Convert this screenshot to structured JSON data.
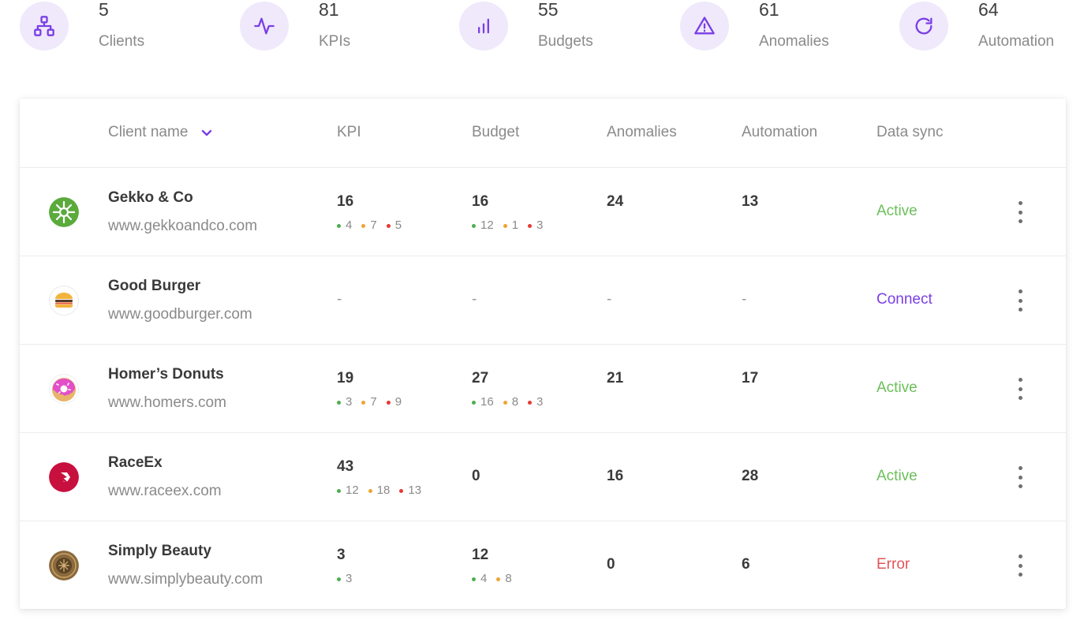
{
  "stats": [
    {
      "value": "5",
      "label": "Clients",
      "icon": "sitemap-icon"
    },
    {
      "value": "81",
      "label": "KPIs",
      "icon": "pulse-icon"
    },
    {
      "value": "55",
      "label": "Budgets",
      "icon": "bar-chart-icon"
    },
    {
      "value": "61",
      "label": "Anomalies",
      "icon": "warning-icon"
    },
    {
      "value": "64",
      "label": "Automation",
      "icon": "refresh-icon"
    }
  ],
  "table": {
    "headers": {
      "client": "Client name",
      "kpi": "KPI",
      "budget": "Budget",
      "anomalies": "Anomalies",
      "automation": "Automation",
      "sync": "Data sync"
    },
    "empty_placeholder": "-",
    "rows": [
      {
        "name": "Gekko & Co",
        "url": "www.gekkoandco.com",
        "logo": "gekko-logo",
        "kpi": {
          "total": "16",
          "green": "4",
          "orange": "7",
          "red": "5"
        },
        "budget": {
          "total": "16",
          "green": "12",
          "orange": "1",
          "red": "3"
        },
        "anomalies": "24",
        "automation": "13",
        "sync": "Active",
        "sync_color": "#6cbf5a"
      },
      {
        "name": "Good Burger",
        "url": "www.goodburger.com",
        "logo": "burger-logo",
        "kpi": null,
        "budget": null,
        "anomalies": null,
        "automation": null,
        "sync": "Connect",
        "sync_color": "#7b3fe4"
      },
      {
        "name": "Homer’s Donuts",
        "url": "www.homers.com",
        "logo": "donut-logo",
        "kpi": {
          "total": "19",
          "green": "3",
          "orange": "7",
          "red": "9"
        },
        "budget": {
          "total": "27",
          "green": "16",
          "orange": "8",
          "red": "3"
        },
        "anomalies": "21",
        "automation": "17",
        "sync": "Active",
        "sync_color": "#6cbf5a"
      },
      {
        "name": "RaceEx",
        "url": "www.raceex.com",
        "logo": "raceex-logo",
        "kpi": {
          "total": "43",
          "green": "12",
          "orange": "18",
          "red": "13"
        },
        "budget": {
          "total": "0"
        },
        "anomalies": "16",
        "automation": "28",
        "sync": "Active",
        "sync_color": "#6cbf5a"
      },
      {
        "name": "Simply Beauty",
        "url": "www.simplybeauty.com",
        "logo": "beauty-logo",
        "kpi": {
          "total": "3",
          "green": "3"
        },
        "budget": {
          "total": "12",
          "green": "4",
          "orange": "8"
        },
        "anomalies": "0",
        "automation": "6",
        "sync": "Error",
        "sync_color": "#e0555a"
      }
    ]
  },
  "colors": {
    "accent": "#7b3fe4",
    "icon_bg": "#efe9fb",
    "dot_green": "#4caf50",
    "dot_orange": "#f0a430",
    "dot_red": "#e53935"
  }
}
